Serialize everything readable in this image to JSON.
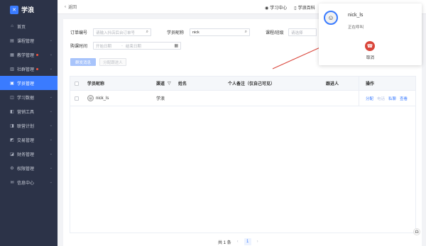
{
  "brand": {
    "name": "学浪",
    "logo_glyph": "✕"
  },
  "sidebar": {
    "items": [
      {
        "label": "首页",
        "icon": "home-icon",
        "glyph": "⌂",
        "dot": false,
        "chevron": false,
        "active": false
      },
      {
        "label": "课程管理",
        "icon": "course-icon",
        "glyph": "▤",
        "dot": false,
        "chevron": true,
        "active": false
      },
      {
        "label": "教学管理",
        "icon": "teaching-icon",
        "glyph": "▦",
        "dot": true,
        "chevron": true,
        "active": false
      },
      {
        "label": "社群管理",
        "icon": "community-icon",
        "glyph": "▥",
        "dot": true,
        "chevron": true,
        "active": false
      },
      {
        "label": "学员管理",
        "icon": "student-icon",
        "glyph": "▣",
        "dot": false,
        "chevron": false,
        "active": true
      },
      {
        "label": "学习数据",
        "icon": "data-icon",
        "glyph": "◫",
        "dot": false,
        "chevron": true,
        "active": false
      },
      {
        "label": "营销工具",
        "icon": "marketing-icon",
        "glyph": "◧",
        "dot": false,
        "chevron": true,
        "active": false
      },
      {
        "label": "联营计划",
        "icon": "alliance-icon",
        "glyph": "◨",
        "dot": false,
        "chevron": true,
        "active": false
      },
      {
        "label": "交易管理",
        "icon": "trade-icon",
        "glyph": "◩",
        "dot": false,
        "chevron": true,
        "active": false
      },
      {
        "label": "财务管理",
        "icon": "finance-icon",
        "glyph": "◪",
        "dot": false,
        "chevron": true,
        "active": false
      },
      {
        "label": "权限管理",
        "icon": "permission-icon",
        "glyph": "⚙",
        "dot": false,
        "chevron": true,
        "active": false
      },
      {
        "label": "信息中心",
        "icon": "message-icon",
        "glyph": "✉",
        "dot": false,
        "chevron": true,
        "active": false
      }
    ]
  },
  "topbar": {
    "back_label": "返回",
    "links": [
      {
        "label": "学习中心",
        "glyph": "◉"
      },
      {
        "label": "学浪百科",
        "glyph": "▯"
      }
    ]
  },
  "filters": {
    "order_label": "订单编号",
    "order_placeholder": "请输入抖店后台订单号",
    "nickname_label": "学员昵称",
    "nickname_value": "nick",
    "course_label": "课程/班级",
    "course_placeholder": "请选择",
    "time_label": "购课时间",
    "start_placeholder": "开始日期",
    "range_sep": "-",
    "end_placeholder": "结束日期"
  },
  "actions": {
    "primary_label": "群发消息",
    "secondary_label": "分配跟进人"
  },
  "table": {
    "columns": {
      "nickname": "学员昵称",
      "channel": "渠道",
      "name": "姓名",
      "remark": "个人备注（仅自己可见）",
      "follower": "跟进人",
      "ops": "操作"
    },
    "rows": [
      {
        "nickname": "nick_ls",
        "channel": "学浪",
        "name": "",
        "remark": "",
        "follower": "",
        "ops": [
          "分配",
          "电话",
          "私聊",
          "查看"
        ]
      }
    ]
  },
  "pager": {
    "total": "共 1 条",
    "current": "1",
    "prev": "‹",
    "next": "›"
  },
  "call_popup": {
    "name": "nick_ls",
    "status": "正在呼叫",
    "hangup_label": "取消",
    "hangup_color": "#d9453a"
  },
  "colors": {
    "accent": "#3a7bff",
    "sidebar_bg": "#2c3348",
    "annotation_arrow": "#d9453a"
  }
}
